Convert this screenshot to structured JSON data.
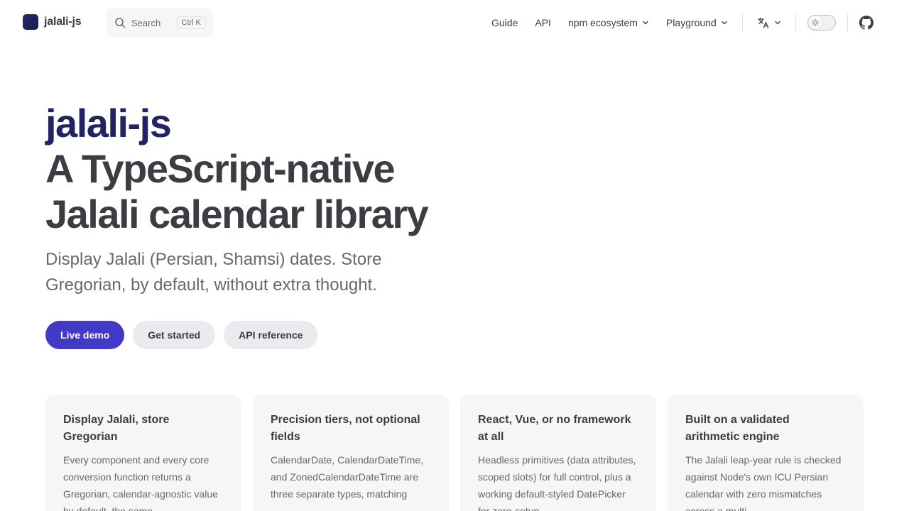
{
  "nav": {
    "brand": "jalali-js",
    "search": {
      "label": "Search",
      "shortcut": "Ctrl K"
    },
    "links": [
      {
        "label": "Guide"
      },
      {
        "label": "API"
      },
      {
        "label": "npm ecosystem",
        "has_dropdown": true
      },
      {
        "label": "Playground",
        "has_dropdown": true
      }
    ],
    "language_icon": "translate-icon",
    "appearance_icon": "sun-icon",
    "social_icon": "github-icon"
  },
  "hero": {
    "name": "jalali-js",
    "text_line1": "A TypeScript-native",
    "text_line2": "Jalali calendar library",
    "tagline": "Display Jalali (Persian, Shamsi) dates. Store Gregorian, by default, without extra thought.",
    "actions": [
      {
        "label": "Live demo",
        "theme": "brand"
      },
      {
        "label": "Get started",
        "theme": "alt"
      },
      {
        "label": "API reference",
        "theme": "alt"
      }
    ]
  },
  "features": [
    {
      "title": "Display Jalali, store Gregorian",
      "details": "Every component and every core conversion function returns a Gregorian, calendar-agnostic value by default, the same"
    },
    {
      "title": "Precision tiers, not optional fields",
      "details": "CalendarDate, CalendarDateTime, and ZonedCalendarDateTime are three separate types, matching"
    },
    {
      "title": "React, Vue, or no framework at all",
      "details": "Headless primitives (data attributes, scoped slots) for full control, plus a working default-styled DatePicker for zero-setup"
    },
    {
      "title": "Built on a validated arithmetic engine",
      "details": "The Jalali leap-year rule is checked against Node's own ICU Persian calendar with zero mismatches across a multi"
    }
  ],
  "colors": {
    "brand": "#4339c6",
    "hero_name": "#232263",
    "text": "#3c3c43",
    "muted": "#67676c",
    "card_bg": "#f6f6f7"
  }
}
